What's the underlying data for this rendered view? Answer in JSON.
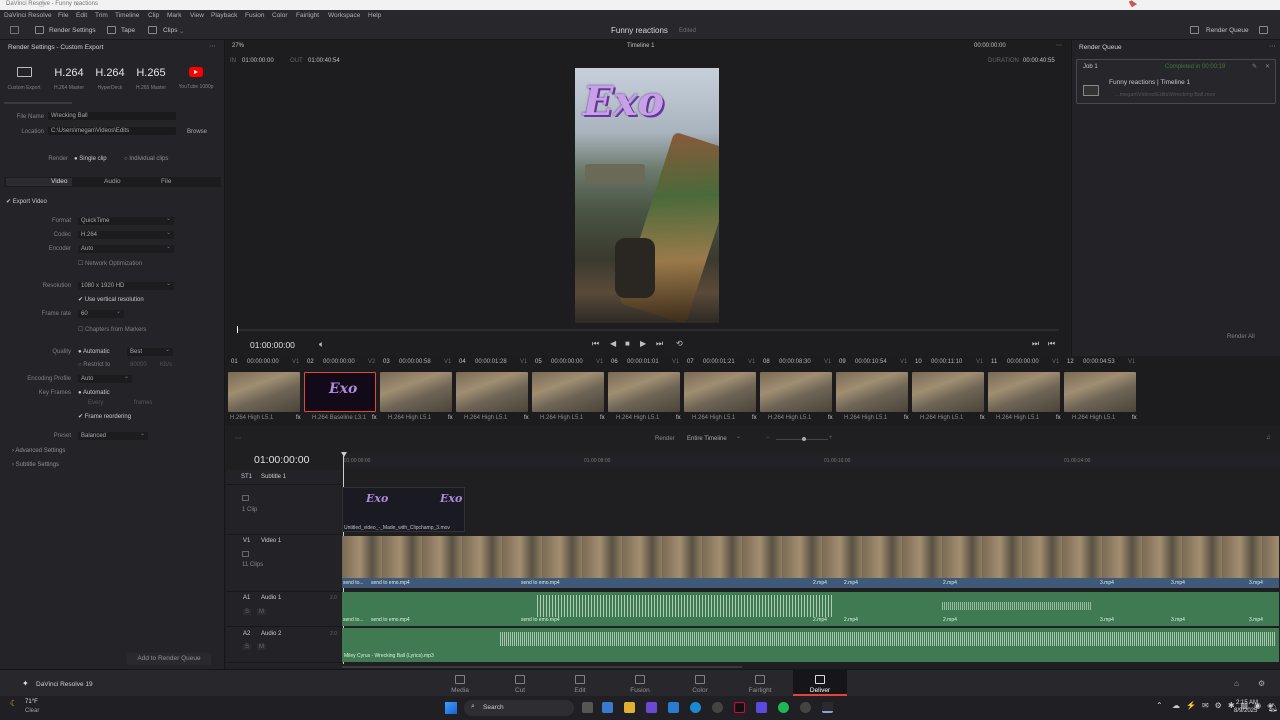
{
  "window": {
    "title": "DaVinci Resolve - Funny reactions",
    "controls": "–  ▢  ✕"
  },
  "menu": [
    "DaVinci Resolve",
    "File",
    "Edit",
    "Trim",
    "Timeline",
    "Clip",
    "Mark",
    "View",
    "Playback",
    "Fusion",
    "Color",
    "Fairlight",
    "Workspace",
    "Help"
  ],
  "toolbar": {
    "render_settings": "Render Settings",
    "tape": "Tape",
    "clips": "Clips",
    "project_title": "Funny reactions",
    "project_status": "Edited",
    "render_queue": "Render Queue"
  },
  "render_settings": {
    "header": "Render Settings - Custom Export",
    "presets": [
      {
        "big": "",
        "small": "Custom Export"
      },
      {
        "big": "H.264",
        "small": "H.264 Master"
      },
      {
        "big": "H.264",
        "small": "HyperDeck"
      },
      {
        "big": "H.265",
        "small": "H.265 Master"
      },
      {
        "big": "",
        "small": "YouTube 1080p"
      }
    ],
    "file_name_label": "File Name",
    "file_name": "Wrecking Ball",
    "location_label": "Location",
    "location": "C:\\Users\\megan\\Videos\\Edits",
    "browse": "Browse",
    "render_label": "Render",
    "single_clip": "Single clip",
    "individual_clips": "Individual clips",
    "tabs": [
      "Video",
      "Audio",
      "File"
    ],
    "export_video": "Export Video",
    "format_label": "Format",
    "format": "QuickTime",
    "codec_label": "Codec",
    "codec": "H.264",
    "encoder_label": "Encoder",
    "encoder": "Auto",
    "network_opt": "Network Optimization",
    "resolution_label": "Resolution",
    "resolution": "1080 x 1920 HD",
    "vertical": "Use vertical resolution",
    "framerate_label": "Frame rate",
    "framerate": "60",
    "chapters": "Chapters from Markers",
    "quality_label": "Quality",
    "quality_auto": "Automatic",
    "quality": "Best",
    "restrict": "Restrict to",
    "restrict_val": "80000",
    "restrict_unit": "Kb/s",
    "encoding_profile_label": "Encoding Profile",
    "encoding_profile": "Auto",
    "keyframes_label": "Key Frames",
    "kf_auto": "Automatic",
    "kf_every": "Every",
    "kf_frames": "frames",
    "frame_reordering": "Frame reordering",
    "preset_label": "Preset",
    "preset": "Balanced",
    "advanced": "Advanced Settings",
    "subtitle": "Subtitle Settings",
    "add_to_queue": "Add to Render Queue"
  },
  "viewer": {
    "zoom": "27%",
    "in_label": "IN",
    "in_tc": "01:00:00:00",
    "out_label": "OUT",
    "out_tc": "01:00:40:54",
    "timeline": "Timeline 1",
    "tc_right": "00:00:00:00",
    "duration_label": "DURATION",
    "duration": "00:00:40:55",
    "play_tc": "01:00:00:00",
    "logo_text": "Exo"
  },
  "render_queue": {
    "header": "Render Queue",
    "job": "Job 1",
    "completed": "Completed in 00:00:19",
    "job_title": "Funny reactions | Timeline 1",
    "job_path": "...megan\\Videos\\Edits\\Wrecking Ball.mov",
    "render_all": "Render All"
  },
  "clips": [
    {
      "num": "01",
      "tc": "00:00:00:00",
      "track": "V1",
      "label": "H.264 High L5.1"
    },
    {
      "num": "02",
      "tc": "00:00:00:00",
      "track": "V2",
      "label": "H.264 Baseline L3.1"
    },
    {
      "num": "03",
      "tc": "00:00:00:58",
      "track": "V1",
      "label": "H.264 High L5.1"
    },
    {
      "num": "04",
      "tc": "00:00:01:28",
      "track": "V1",
      "label": "H.264 High L5.1"
    },
    {
      "num": "05",
      "tc": "00:00:00:00",
      "track": "V1",
      "label": "H.264 High L5.1"
    },
    {
      "num": "06",
      "tc": "00:00:01:01",
      "track": "V1",
      "label": "H.264 High L5.1"
    },
    {
      "num": "07",
      "tc": "00:00:01:21",
      "track": "V1",
      "label": "H.264 High L5.1"
    },
    {
      "num": "08",
      "tc": "00:00:08:30",
      "track": "V1",
      "label": "H.264 High L5.1"
    },
    {
      "num": "09",
      "tc": "00:00:10:54",
      "track": "V1",
      "label": "H.264 High L5.1"
    },
    {
      "num": "10",
      "tc": "00:00:11:10",
      "track": "V1",
      "label": "H.264 High L5.1"
    },
    {
      "num": "11",
      "tc": "00:00:00:00",
      "track": "V1",
      "label": "H.264 High L5.1"
    },
    {
      "num": "12",
      "tc": "00:00:04:53",
      "track": "V1",
      "label": "H.264 High L5.1"
    }
  ],
  "timeline": {
    "render_label": "Render",
    "render_scope": "Entire Timeline",
    "tc": "01:00:00:00",
    "ruler": [
      "01:00:00:00",
      "01:00:08:00",
      "01:00:16:00",
      "01:00:24:00"
    ],
    "tracks": [
      {
        "id": "ST1",
        "name": "Subtitle 1",
        "info": "1 Clip"
      },
      {
        "id": "V1",
        "name": "Video 1",
        "info": "11 Clips"
      },
      {
        "id": "A1",
        "name": "Audio 1",
        "level": "2.0"
      },
      {
        "id": "A2",
        "name": "Audio 2",
        "level": "2.0"
      }
    ],
    "sub_clip": "Untitled_video_-_Made_with_Clipchamp_3.mov",
    "v_labels": [
      "send to...",
      "send to emo.mp4",
      "send to emo.mp4",
      "2.mp4",
      "2.mp4",
      "2.mp4",
      "3.mp4",
      "3.mp4",
      "3.mp4"
    ],
    "a1_labels": [
      "send to...",
      "send to emo.mp4",
      "send to emo.mp4",
      "2.mp4",
      "2.mp4",
      "2.mp4",
      "3.mp4",
      "3.mp4",
      "3.mp4"
    ],
    "a2_label": "Miley Cyrus - Wrecking Ball (Lyrics).mp3"
  },
  "pages": [
    "Media",
    "Cut",
    "Edit",
    "Fusion",
    "Color",
    "Fairlight",
    "Deliver"
  ],
  "active_page": "Deliver",
  "app_name": "DaVinci Resolve 19",
  "taskbar": {
    "weather_temp": "71°F",
    "weather_desc": "Clear",
    "search": "Search",
    "time": "2:15 AM",
    "date": "8/9/2025"
  },
  "colors": {
    "accent": "#e0453a",
    "audio": "#3f7a52",
    "video_clip": "#3e5a78",
    "youtube": "#ff0000"
  }
}
